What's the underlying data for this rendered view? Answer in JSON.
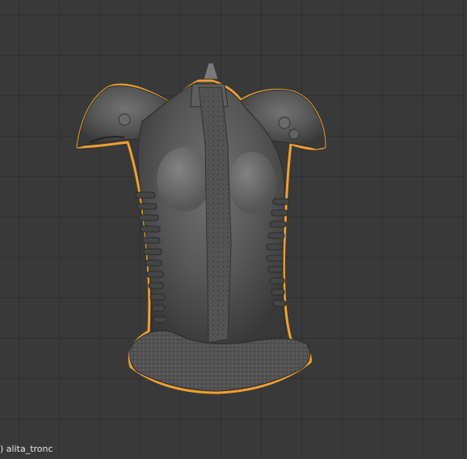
{
  "viewport": {
    "object_label": ") alita_tronc",
    "selection_outline_color": "#f0a030",
    "background_color": "#393939",
    "grid_color": "#2f2f2f",
    "mesh_color": "#5a5a5a"
  }
}
